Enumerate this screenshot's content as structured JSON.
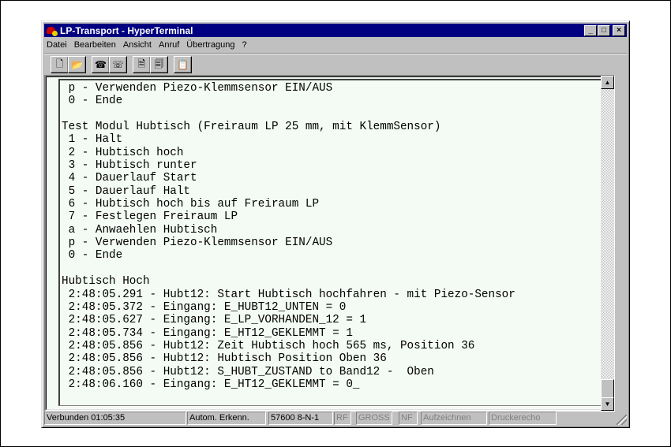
{
  "window": {
    "title": "LP-Transport - HyperTerminal"
  },
  "menu": [
    "Datei",
    "Bearbeiten",
    "Ansicht",
    "Anruf",
    "Übertragung",
    "?"
  ],
  "toolbar": [
    {
      "icon": "new-document-icon"
    },
    {
      "icon": "open-folder-icon"
    },
    {
      "icon": "phone-connect-icon"
    },
    {
      "icon": "phone-disconnect-icon"
    },
    {
      "icon": "send-file-icon"
    },
    {
      "icon": "receive-file-icon"
    },
    {
      "icon": "properties-icon"
    }
  ],
  "terminal": {
    "lines": [
      " p - Verwenden Piezo-Klemmsensor EIN/AUS",
      " 0 - Ende",
      "",
      "Test Modul Hubtisch (Freiraum LP 25 mm, mit KlemmSensor)",
      " 1 - Halt",
      " 2 - Hubtisch hoch",
      " 3 - Hubtisch runter",
      " 4 - Dauerlauf Start",
      " 5 - Dauerlauf Halt",
      " 6 - Hubtisch hoch bis auf Freiraum LP",
      " 7 - Festlegen Freiraum LP",
      " a - Anwaehlen Hubtisch",
      " p - Verwenden Piezo-Klemmsensor EIN/AUS",
      " 0 - Ende",
      "",
      "Hubtisch Hoch",
      " 2:48:05.291 - Hubt12: Start Hubtisch hochfahren - mit Piezo-Sensor",
      " 2:48:05.372 - Eingang: E_HUBT12_UNTEN = 0",
      " 2:48:05.627 - Eingang: E_LP_VORHANDEN_12 = 1",
      " 2:48:05.734 - Eingang: E_HT12_GEKLEMMT = 1",
      " 2:48:05.856 - Hubt12: Zeit Hubtisch hoch 565 ms, Position 36",
      " 2:48:05.856 - Hubt12: Hubtisch Position Oben 36",
      " 2:48:05.856 - Hubt12: S_HUBT_ZUSTAND to Band12 -  Oben",
      " 2:48:06.160 - Eingang: E_HT12_GEKLEMMT = 0_"
    ]
  },
  "status": {
    "connected": "Verbunden 01:05:35",
    "detect": "Autom. Erkenn.",
    "port": "57600 8-N-1",
    "rf": "RF",
    "gross": "GROSS",
    "nf": "NF",
    "record": "Aufzeichnen",
    "printecho": "Druckerecho"
  }
}
